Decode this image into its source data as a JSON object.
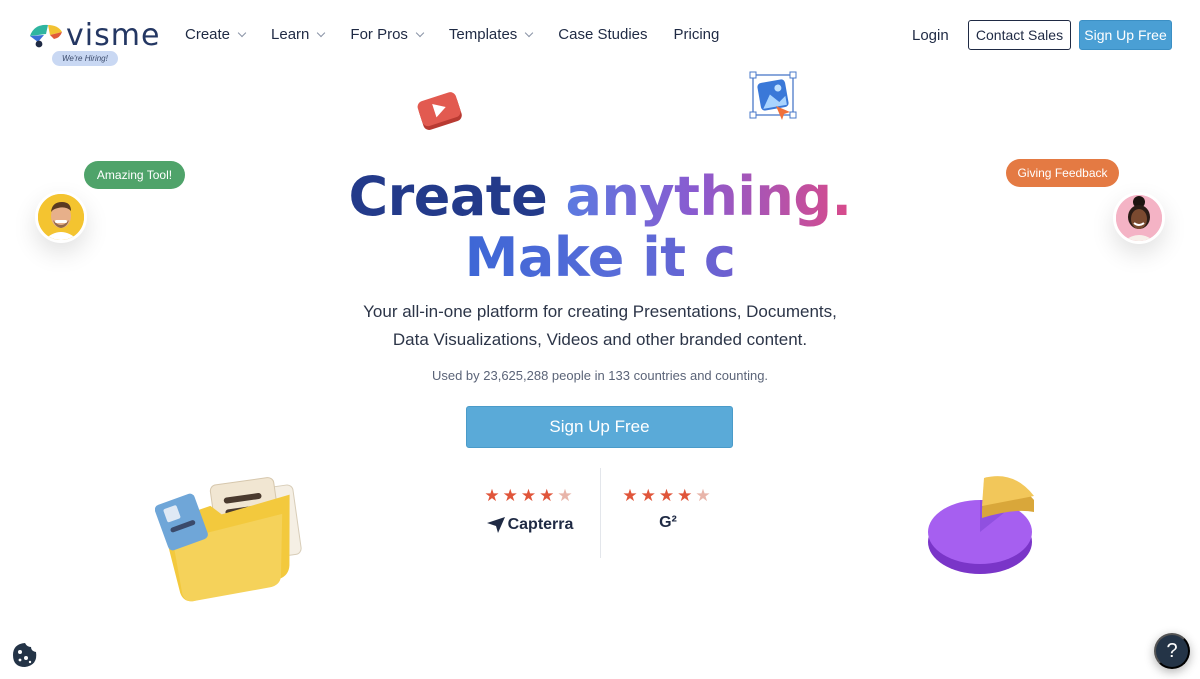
{
  "brand": {
    "name": "visme",
    "hiring_badge": "We're Hiring!"
  },
  "nav": {
    "items": [
      {
        "label": "Create",
        "dropdown": true
      },
      {
        "label": "Learn",
        "dropdown": true
      },
      {
        "label": "For Pros",
        "dropdown": true
      },
      {
        "label": "Templates",
        "dropdown": true
      },
      {
        "label": "Case Studies",
        "dropdown": false
      },
      {
        "label": "Pricing",
        "dropdown": false
      }
    ],
    "login": "Login",
    "contact_sales": "Contact Sales",
    "signup": "Sign Up Free"
  },
  "hero": {
    "line1_a": "Create ",
    "line1_b": "anything.",
    "line2": "Make it c",
    "subtitle_1": "Your all-in-one platform for creating Presentations, Documents,",
    "subtitle_2": "Data Visualizations, Videos and other branded content.",
    "used_by": "Used by 23,625,288 people in 133 countries and counting.",
    "cta": "Sign Up Free"
  },
  "ratings": {
    "capterra": {
      "label": "Capterra",
      "stars": "★★★★"
    },
    "g2": {
      "label": "G²",
      "stars": "★★★★"
    }
  },
  "testimonials": {
    "left": "Amazing Tool!",
    "right": "Giving Feedback"
  },
  "help": {
    "label": "?"
  },
  "colors": {
    "accent": "#4a9fd4",
    "navy": "#233a8a",
    "star": "#e0553a",
    "green_bubble": "#4fa36a",
    "orange_bubble": "#e47a43"
  }
}
